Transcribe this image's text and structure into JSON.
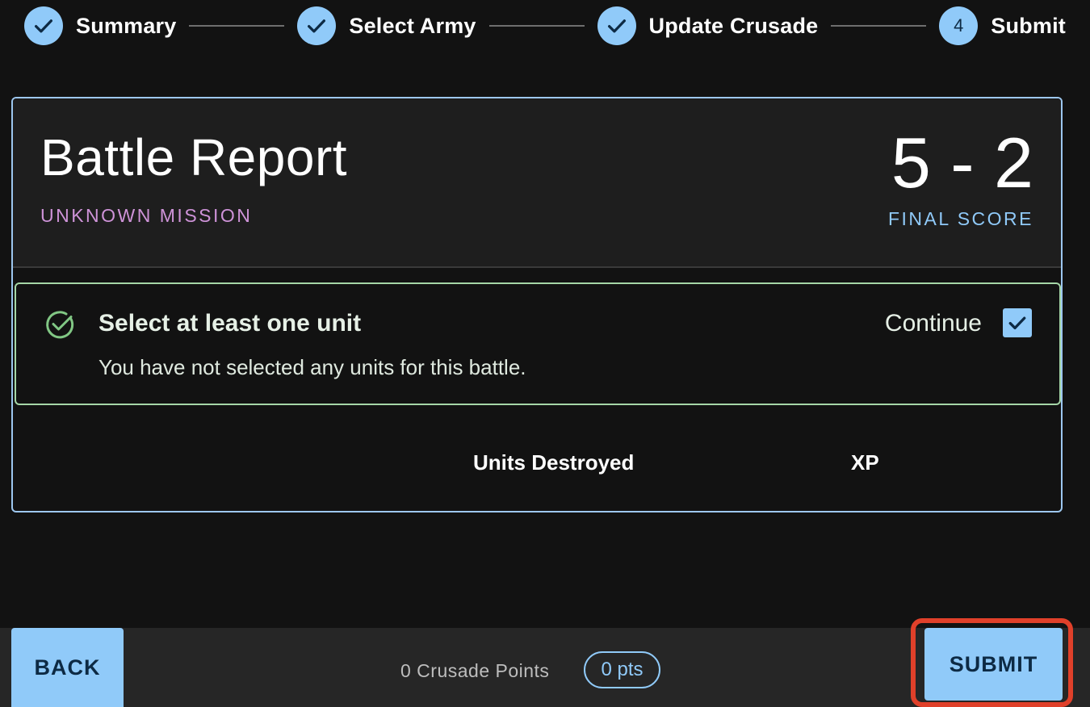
{
  "stepper": {
    "steps": [
      {
        "label": "Summary",
        "state": "complete",
        "icon": "check-icon"
      },
      {
        "label": "Select Army",
        "state": "complete",
        "icon": "check-icon"
      },
      {
        "label": "Update Crusade",
        "state": "complete",
        "icon": "check-icon"
      },
      {
        "label": "Submit",
        "state": "active",
        "number": "4"
      }
    ]
  },
  "report": {
    "title": "Battle Report",
    "mission": "UNKNOWN MISSION",
    "score": "5 - 2",
    "score_label": "FINAL SCORE"
  },
  "alert": {
    "icon": "check-circle-outline-icon",
    "title": "Select at least one unit",
    "message": "You have not selected any units for this battle.",
    "continue_label": "Continue",
    "continue_checked": true
  },
  "table": {
    "columns": [
      "Units Destroyed",
      "XP"
    ]
  },
  "footer": {
    "back_label": "BACK",
    "points_text": "0 Crusade Points",
    "points_chip": "0 pts",
    "submit_label": "SUBMIT"
  },
  "colors": {
    "accent": "#90caf9",
    "mission": "#ce93d8",
    "success": "#a5d6a7",
    "highlight": "#e0402a",
    "background": "#121212"
  }
}
